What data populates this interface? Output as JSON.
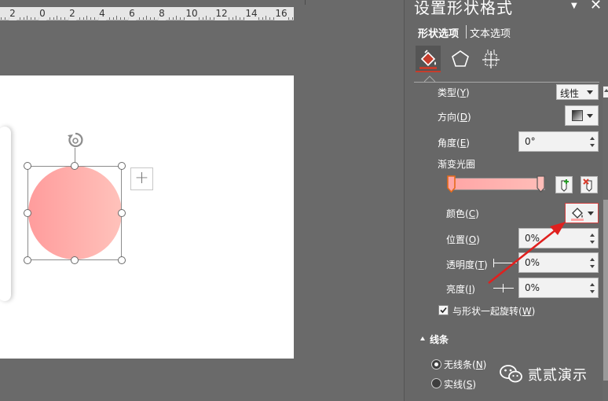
{
  "ruler": {
    "labels": [
      "2",
      "0",
      "2",
      "4",
      "6",
      "8",
      "10",
      "12",
      "14",
      "16"
    ]
  },
  "panel": {
    "title": "设置形状格式",
    "tabs": {
      "shape": "形状选项",
      "text": "文本选项"
    }
  },
  "fill": {
    "type_label": "类型(",
    "type_key": "Y",
    "type_value": "线性",
    "direction_label": "方向(",
    "direction_key": "D",
    "angle_label": "角度(",
    "angle_key": "E",
    "angle_value": "0°",
    "stops_label": "渐变光圈",
    "color_label": "颜色(",
    "color_key": "C",
    "position_label": "位置(",
    "position_key": "O",
    "position_value": "0%",
    "transparency_label": "透明度(",
    "transparency_key": "T",
    "transparency_value": "0%",
    "brightness_label": "亮度(",
    "brightness_key": "I",
    "brightness_value": "0%",
    "rotate_label": "与形状一起旋转(",
    "rotate_key": "W",
    "close_paren": ")",
    "gradient_start_color": "#ffa6a6",
    "gradient_end_color": "#ffbdb8"
  },
  "line": {
    "section_label": "线条",
    "no_line_label": "无线条(",
    "no_line_key": "N",
    "solid_label": "实线(",
    "solid_key": "S"
  },
  "watermark": {
    "text": "贰贰演示"
  },
  "colors": {
    "accent_red": "#e0201e",
    "circle_start": "#ff9c9c",
    "circle_end": "#ffc2bb",
    "panel_bg": "#676767"
  }
}
